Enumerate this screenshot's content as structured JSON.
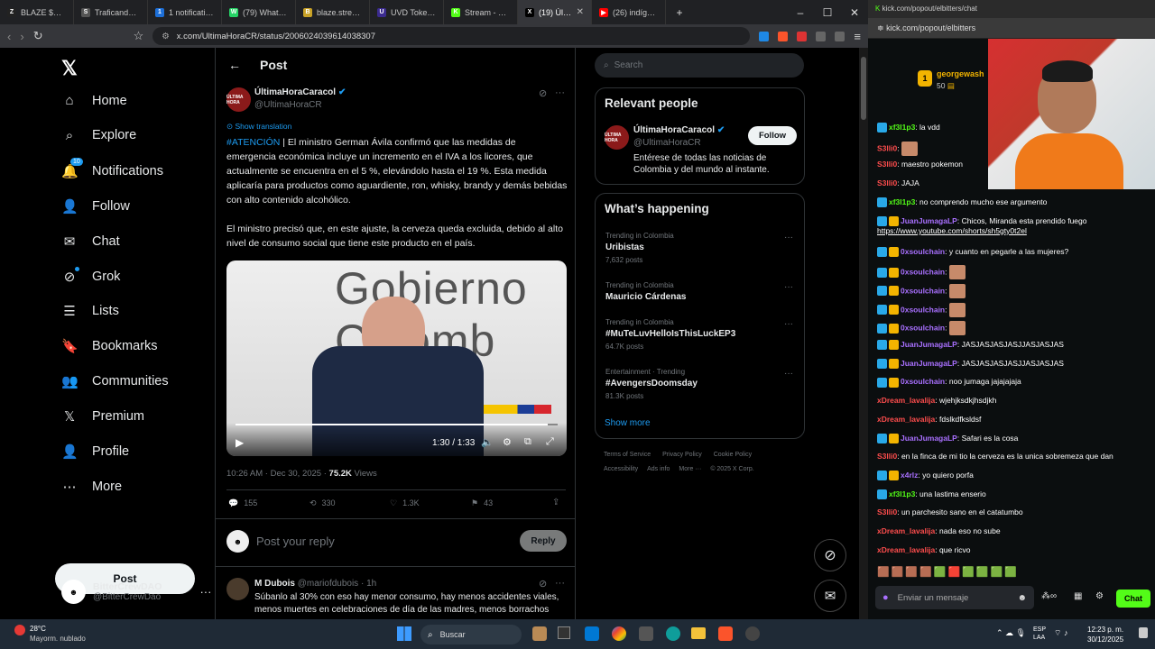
{
  "browser": {
    "tabs": [
      {
        "title": "BLAZE $0.00558",
        "fav": "Z",
        "color": "#222"
      },
      {
        "title": "Traficando A",
        "fav": "S",
        "color": "#555"
      },
      {
        "title": "1 notification",
        "fav": "1",
        "color": "#1d6fd8"
      },
      {
        "title": "(79) WhatsApp",
        "fav": "W",
        "color": "#25d366"
      },
      {
        "title": "blaze.stream/st",
        "fav": "B",
        "color": "#c9a227"
      },
      {
        "title": "UVD Token | Av",
        "fav": "U",
        "color": "#3b2b8f"
      },
      {
        "title": "Stream - Kick",
        "fav": "K",
        "color": "#53fc18"
      },
      {
        "title": "(19) Última",
        "fav": "X",
        "color": "#000"
      },
      {
        "title": "(26) indígenas b",
        "fav": "▶",
        "color": "#ff0000"
      }
    ],
    "url": "x.com/UltimaHoraCR/status/2006024039614038307",
    "new_tab": "+"
  },
  "nav": {
    "items": [
      "Home",
      "Explore",
      "Notifications",
      "Follow",
      "Chat",
      "Grok",
      "Lists",
      "Bookmarks",
      "Communities",
      "Premium",
      "Profile",
      "More"
    ],
    "notif_badge": "10",
    "post_label": "Post",
    "account_name": "BitterCrewDAO",
    "account_handle": "@BitterCrewDao"
  },
  "post": {
    "header": "Post",
    "author_name": "ÚltimaHoraCaracol",
    "author_handle": "@UltimaHoraCR",
    "show_translation": "Show translation",
    "hashtag": "#ATENCIÓN",
    "text1": " | El ministro German Ávila confirmó que las medidas de emergencia económica incluye un incremento en el IVA a los licores, que actualmente se encuentra en el 5 %, elevándolo hasta el 19 %. Esta medida aplicaría para productos como aguardiente, ron, whisky, brandy y demás bebidas con alto contenido alcohólico.",
    "text2": "El ministro precisó que, en este ajuste, la cerveza queda excluida, debido al alto nivel de consumo social que tiene este producto en el país.",
    "video_time": "1:30 / 1:33",
    "video_progress": 0.97,
    "video_bg_text": "Gobierno Colomb",
    "timestamp": "10:26 AM · Dec 30, 2025 · ",
    "views": "75.2K",
    "views_label": " Views",
    "replies": "155",
    "reposts": "330",
    "likes": "1.3K",
    "bookmarks": "43",
    "reply_placeholder": "Post your reply",
    "reply_button": "Reply",
    "reply_author": "M Dubois",
    "reply_handle": "@mariofdubois · 1h",
    "reply_text": "Súbanlo al 30% con eso hay menor consumo, hay menos accidentes viales, menos muertes en celebraciones de día de las madres, menos borrachos"
  },
  "sidebar": {
    "search_placeholder": "Search",
    "relevant_title": "Relevant people",
    "person_name": "ÚltimaHoraCaracol",
    "person_handle": "@UltimaHoraCR",
    "follow_label": "Follow",
    "person_bio": "Entérese de todas las noticias de Colombia y del mundo al instante.",
    "happening_title": "What’s happening",
    "trends": [
      {
        "cat": "Trending in Colombia",
        "name": "Uribistas",
        "count": "7,632 posts"
      },
      {
        "cat": "Trending in Colombia",
        "name": "Mauricio Cárdenas",
        "count": ""
      },
      {
        "cat": "Trending in Colombia",
        "name": "#MuTeLuvHelloIsThisLuckEP3",
        "count": "64.7K posts"
      },
      {
        "cat": "Entertainment · Trending",
        "name": "#AvengersDoomsday",
        "count": "81.3K posts"
      }
    ],
    "show_more": "Show more",
    "footer1": [
      "Terms of Service",
      "Privacy Policy",
      "Cookie Policy"
    ],
    "footer2": [
      "Accessibility",
      "Ads info",
      "More ···",
      "© 2025 X Corp."
    ]
  },
  "kick": {
    "url_top": "kick.com/popout/elbitters/chat",
    "url": "kick.com/popout/elbitters",
    "top_user": "georgewash",
    "top_amount": "50",
    "messages": [
      {
        "user": "xf3l1p3",
        "text": "la vdd",
        "c": "u1"
      },
      {
        "user": "S3lli0",
        "text": "",
        "c": "u3",
        "emote": true
      },
      {
        "user": "S3lli0",
        "text": "maestro pokemon",
        "c": "u3"
      },
      {
        "user": "S3lli0",
        "text": "JAJA",
        "c": "u3"
      },
      {
        "user": "xf3l1p3",
        "text": "no comprendo mucho ese argumento",
        "c": "u1"
      },
      {
        "user": "JuanJumagaLP",
        "text": "Chicos, Miranda esta prendido fuego",
        "c": "u2",
        "link": "https://www.youtube.com/shorts/sh5gty0t2el"
      },
      {
        "user": "0xsoulchain",
        "text": "y cuanto en pegarle a las mujeres?",
        "c": "u2"
      },
      {
        "user": "0xsoulchain",
        "text": "",
        "c": "u2",
        "emote": true
      },
      {
        "user": "0xsoulchain",
        "text": "",
        "c": "u2",
        "emote": true
      },
      {
        "user": "0xsoulchain",
        "text": "",
        "c": "u2",
        "emote": true
      },
      {
        "user": "0xsoulchain",
        "text": "",
        "c": "u2",
        "emote": true
      },
      {
        "user": "JuanJumagaLP",
        "text": "JASJASJASJASJJASJASJAS",
        "c": "u2"
      },
      {
        "user": "JuanJumagaLP",
        "text": "JASJASJASJASJJASJASJAS",
        "c": "u2"
      },
      {
        "user": "0xsoulchain",
        "text": "noo jumaga jajajajaja",
        "c": "u2"
      },
      {
        "user": "xDream_lavalija",
        "text": "wjehjksdkjhsdjkh",
        "c": "u3"
      },
      {
        "user": "xDream_lavalija",
        "text": "fdslkdfksldsf",
        "c": "u3"
      },
      {
        "user": "JuanJumagaLP",
        "text": "Safari es la cosa",
        "c": "u2"
      },
      {
        "user": "S3lli0",
        "text": "en la finca de mi tio la cerveza es la unica sobremeza que dan",
        "c": "u3"
      },
      {
        "user": "x4rlz",
        "text": "yo quiero porfa",
        "c": "u2"
      },
      {
        "user": "xf3l1p3",
        "text": "una lastima enserio",
        "c": "u1"
      },
      {
        "user": "S3lli0",
        "text": "un parchesito sano en el catatumbo",
        "c": "u3"
      },
      {
        "user": "xDream_lavalija",
        "text": "nada eso no sube",
        "c": "u3"
      },
      {
        "user": "xDream_lavalija",
        "text": "que ricvo",
        "c": "u3"
      }
    ],
    "input_placeholder": "Enviar un mensaje",
    "chat_button": "Chat"
  },
  "taskbar": {
    "temp": "28°C",
    "weather": "Mayorm. nublado",
    "search": "Buscar",
    "lang1": "ESP",
    "lang2": "LAA",
    "time": "12:23 p. m.",
    "date": "30/12/2025"
  }
}
